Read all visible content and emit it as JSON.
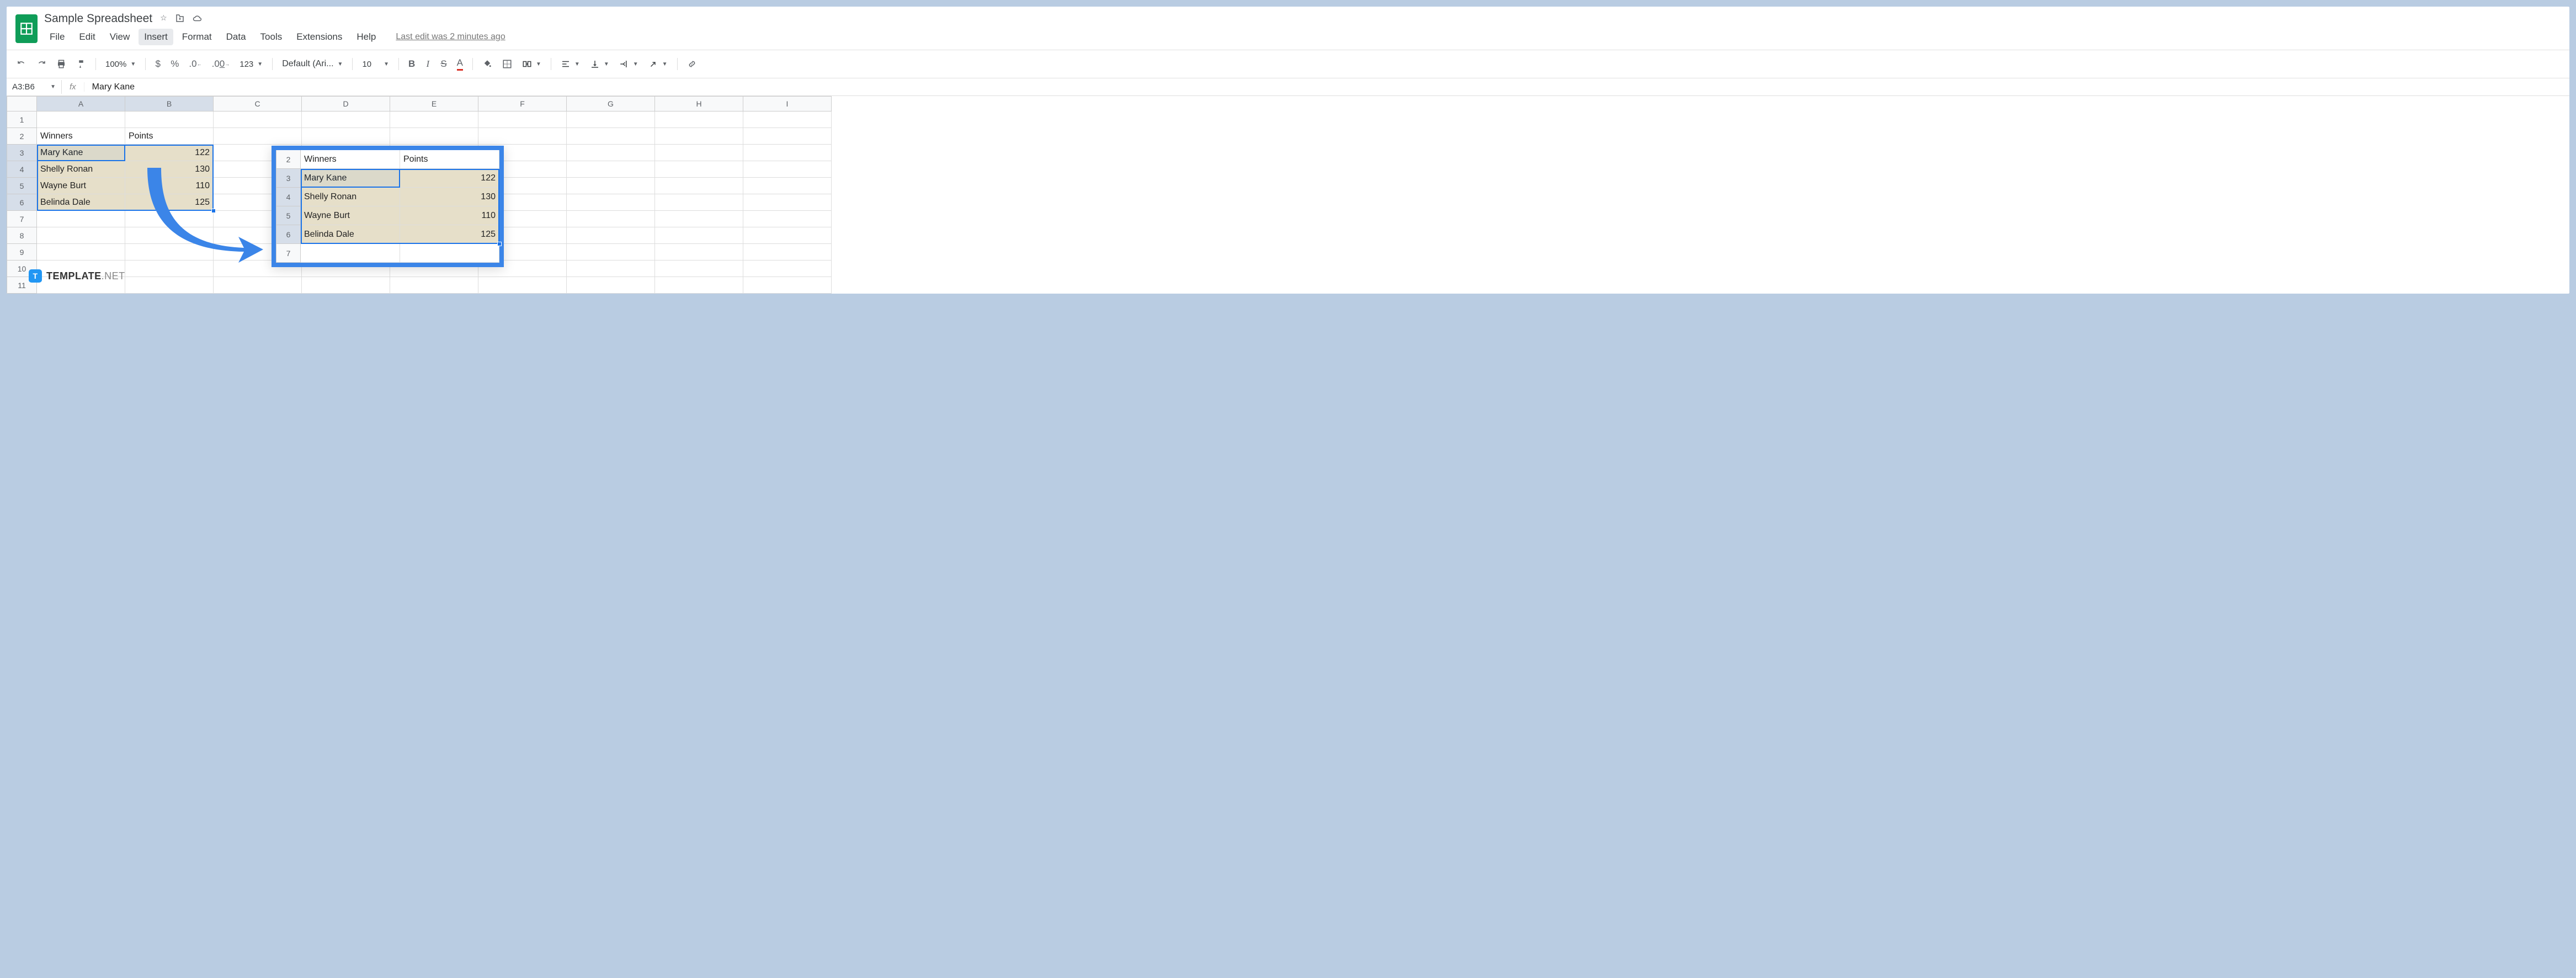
{
  "header": {
    "title": "Sample Spreadsheet",
    "menus": [
      "File",
      "Edit",
      "View",
      "Insert",
      "Format",
      "Data",
      "Tools",
      "Extensions",
      "Help"
    ],
    "active_menu": "Insert",
    "last_edit": "Last edit was 2 minutes ago"
  },
  "toolbar": {
    "zoom": "100%",
    "currency": "$",
    "percent": "%",
    "dec_dec": ".0",
    "inc_dec": ".00",
    "num_fmt": "123",
    "font": "Default (Ari...",
    "font_size": "10",
    "bold": "B",
    "italic": "I",
    "strike": "S",
    "text_color": "A"
  },
  "fx": {
    "cell_ref": "A3:B6",
    "fx_label": "fx",
    "value": "Mary Kane"
  },
  "columns": [
    "A",
    "B",
    "C",
    "D",
    "E",
    "F",
    "G",
    "H",
    "I"
  ],
  "rows": [
    1,
    2,
    3,
    4,
    5,
    6,
    7,
    8,
    9,
    10,
    11
  ],
  "data": {
    "r2": {
      "A": "Winners",
      "B": "Points"
    },
    "r3": {
      "A": "Mary Kane",
      "B": "122"
    },
    "r4": {
      "A": "Shelly Ronan",
      "B": "130"
    },
    "r5": {
      "A": "Wayne Burt",
      "B": "110"
    },
    "r6": {
      "A": "Belinda Dale",
      "B": "125"
    }
  },
  "callout": {
    "rows": [
      2,
      3,
      4,
      5,
      6,
      7
    ],
    "r2": {
      "A": "Winners",
      "B": "Points"
    },
    "r3": {
      "A": "Mary Kane",
      "B": "122"
    },
    "r4": {
      "A": "Shelly Ronan",
      "B": "130"
    },
    "r5": {
      "A": "Wayne Burt",
      "B": "110"
    },
    "r6": {
      "A": "Belinda Dale",
      "B": "125"
    }
  },
  "watermark": {
    "brand": "TEMPLATE",
    "ext": ".NET",
    "logo": "T"
  }
}
